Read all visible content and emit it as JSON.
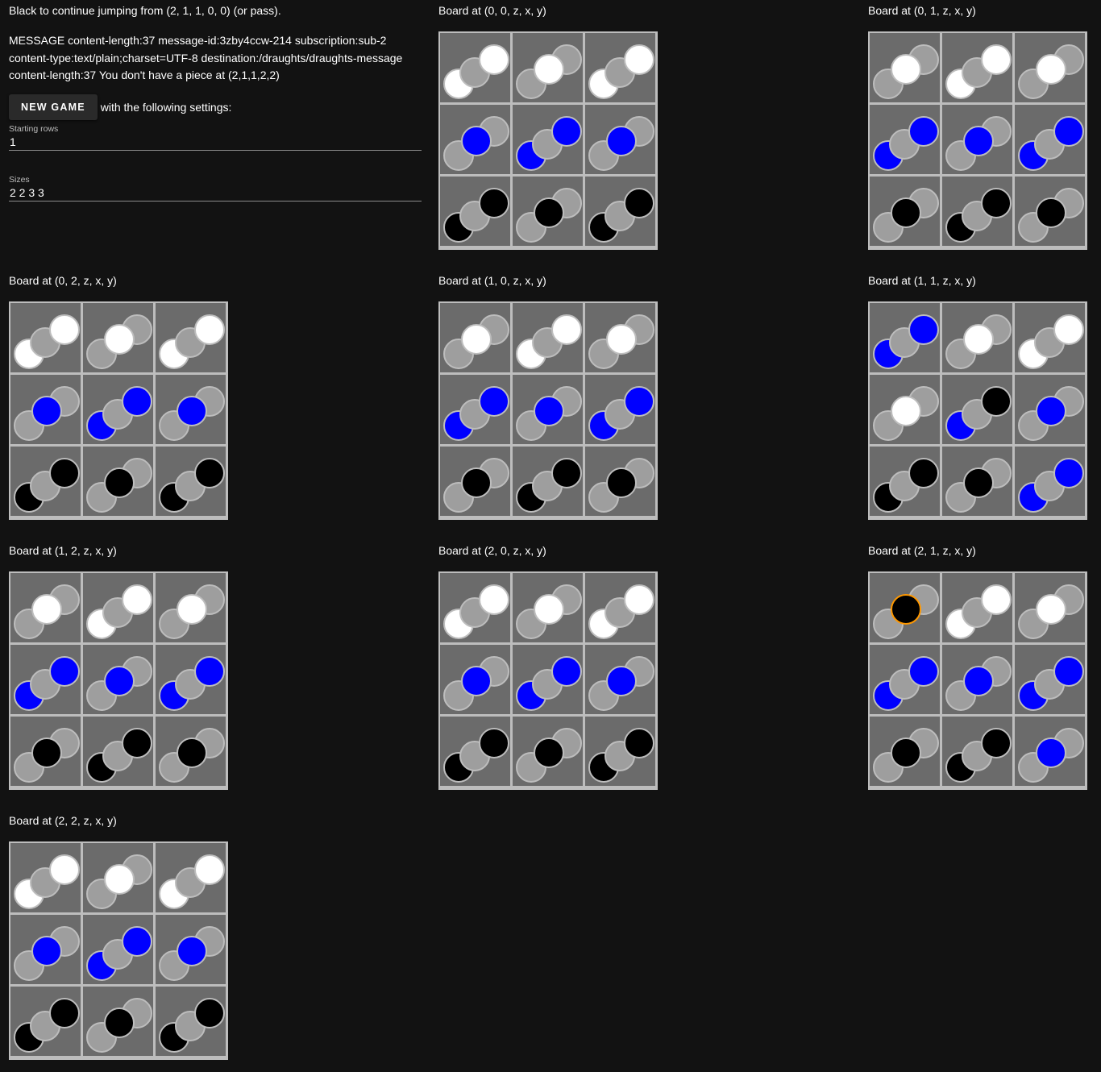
{
  "status": "Black to continue jumping from (2, 1, 1, 0, 0) (or pass).",
  "message": "MESSAGE content-length:37 message-id:3zby4ccw-214 subscription:sub-2 content-type:text/plain;charset=UTF-8 destination:/draughts/draughts-message content-length:37 You don't have a piece at (2,1,1,2,2)",
  "new_game_label": "NEW GAME",
  "settings_text": "with the following settings:",
  "fields": {
    "rows_label": "Starting rows",
    "rows_value": "1",
    "sizes_label": "Sizes",
    "sizes_value": "2 2 3 3"
  },
  "colors": {
    "empty": "#9e9e9e",
    "white": "#ffffff",
    "blue": "#0000ff",
    "black": "#000000",
    "selected_ring": "#ff9800",
    "cell": "#6b6b6b",
    "grid": "#bdbdbd"
  },
  "boards": [
    {
      "title": "Board at (0, 0, z, x, y)",
      "rows": [
        [
          "W1",
          "W0",
          "W1"
        ],
        [
          "B0",
          "B1",
          "B0"
        ],
        [
          "K1",
          "K0",
          "K1"
        ]
      ]
    },
    {
      "title": "Board at (0, 1, z, x, y)",
      "rows": [
        [
          "W0",
          "W1",
          "W0"
        ],
        [
          "B1",
          "B0",
          "B1"
        ],
        [
          "K0",
          "K1",
          "K0"
        ]
      ]
    },
    {
      "title": "Board at (0, 2, z, x, y)",
      "rows": [
        [
          "W1",
          "W0",
          "W1"
        ],
        [
          "B0",
          "B1",
          "B0"
        ],
        [
          "K1",
          "K0",
          "K1"
        ]
      ]
    },
    {
      "title": "Board at (1, 0, z, x, y)",
      "rows": [
        [
          "W0",
          "W1",
          "W0"
        ],
        [
          "B1",
          "B0",
          "B1"
        ],
        [
          "K0",
          "K1",
          "K0"
        ]
      ]
    },
    {
      "title": "Board at (1, 1, z, x, y)",
      "rows": [
        [
          "B1",
          "W0",
          "W1"
        ],
        [
          "W0",
          "B1K",
          "B0"
        ],
        [
          "K1",
          "K0",
          "B1"
        ]
      ]
    },
    {
      "title": "Board at (1, 2, z, x, y)",
      "rows": [
        [
          "W0",
          "W1",
          "W0"
        ],
        [
          "B1",
          "B0",
          "B1"
        ],
        [
          "K0",
          "K1",
          "K0"
        ]
      ]
    },
    {
      "title": "Board at (2, 0, z, x, y)",
      "rows": [
        [
          "W1",
          "W0",
          "W1"
        ],
        [
          "B0",
          "B1",
          "B0"
        ],
        [
          "K1",
          "K0",
          "K1"
        ]
      ]
    },
    {
      "title": "Board at (2, 1, z, x, y)",
      "rows": [
        [
          "S0",
          "W1",
          "W0"
        ],
        [
          "B1",
          "B0",
          "B1"
        ],
        [
          "K0",
          "K1",
          "B0"
        ]
      ]
    },
    {
      "title": "Board at (2, 2, z, x, y)",
      "rows": [
        [
          "W1",
          "W0",
          "W1"
        ],
        [
          "B0",
          "B1",
          "B0"
        ],
        [
          "K1",
          "K0",
          "K1"
        ]
      ]
    }
  ]
}
